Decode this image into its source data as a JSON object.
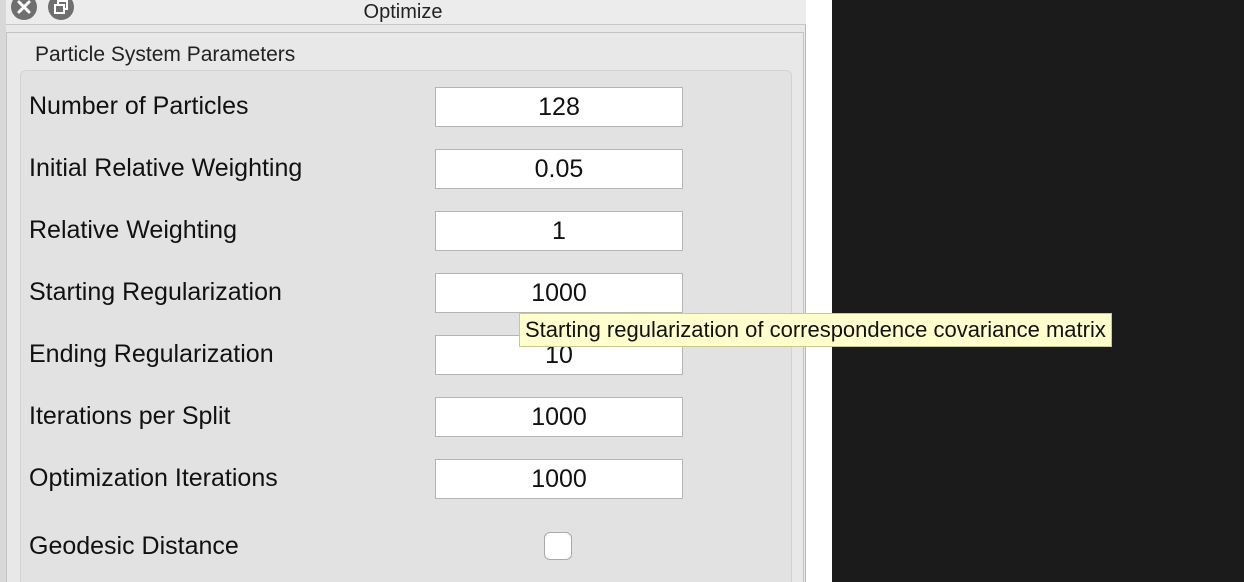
{
  "window": {
    "title": "Optimize"
  },
  "group": {
    "title": "Particle System Parameters"
  },
  "params": [
    {
      "label": "Number of Particles",
      "value": "128"
    },
    {
      "label": "Initial Relative Weighting",
      "value": "0.05"
    },
    {
      "label": "Relative Weighting",
      "value": "1"
    },
    {
      "label": "Starting Regularization",
      "value": "1000"
    },
    {
      "label": "Ending Regularization",
      "value": "10"
    },
    {
      "label": "Iterations per Split",
      "value": "1000"
    },
    {
      "label": "Optimization Iterations",
      "value": "1000"
    }
  ],
  "geodesic": {
    "label": "Geodesic Distance",
    "checked": false
  },
  "tooltip": {
    "text": "Starting regularization of correspondence covariance matrix"
  },
  "icons": {
    "close": "close-icon",
    "float": "float-icon"
  }
}
